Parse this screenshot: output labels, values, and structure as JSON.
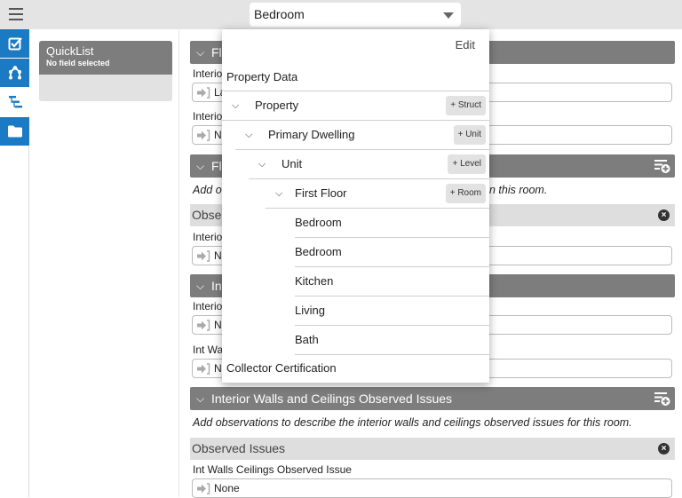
{
  "topbar": {
    "menu_icon": "hamburger-icon",
    "room_selector": {
      "value": "Bedroom",
      "icon": "caret-down-icon"
    }
  },
  "leftrail": {
    "items": [
      {
        "name": "checklist",
        "icon": "checkbox-icon",
        "active": true
      },
      {
        "name": "structure",
        "icon": "node-graph-icon",
        "active": true
      },
      {
        "name": "hierarchy",
        "icon": "tree-hierarchy-icon",
        "active": false
      },
      {
        "name": "files",
        "icon": "folder-icon",
        "active": true
      }
    ]
  },
  "quicklist": {
    "title": "QuickList",
    "subtitle": "No field selected"
  },
  "form": {
    "sections": [
      {
        "title": "Flooring",
        "title_visible": "Flo",
        "fields": [
          {
            "label": "Interior",
            "label_visible": "Interio",
            "value_visible": "La"
          },
          {
            "label": "Interior",
            "label_visible": "Interio",
            "value_visible": "No"
          }
        ]
      },
      {
        "title": "Flooring Observed Issues",
        "title_visible": "Flo",
        "description_visible_start": "Add o",
        "description_visible_end": "n this room.",
        "observation_bar": "Obser",
        "fields": [
          {
            "label": "Interior",
            "label_visible": "Interio",
            "value_visible": "No"
          }
        ]
      },
      {
        "title": "Interior Walls and Ceilings",
        "title_visible": "Int",
        "fields": [
          {
            "label": "Interior",
            "label_visible": "Interio",
            "value_visible": "No"
          },
          {
            "label": "Int Walls",
            "label_visible": "Int Wa",
            "value_visible": "No"
          }
        ]
      },
      {
        "title": "Interior Walls and Ceilings Observed Issues",
        "description": "Add observations to describe the interior walls and ceilings observed issues for this room.",
        "observation_bar": "Observed Issues",
        "fields": [
          {
            "label": "Int Walls Ceilings Observed Issue",
            "value": "None"
          }
        ]
      }
    ]
  },
  "popover": {
    "edit_label": "Edit",
    "header": "Property Data",
    "tree": [
      {
        "label": "Property",
        "level": 0,
        "collapsible": true,
        "add_button": "+ Struct"
      },
      {
        "label": "Primary Dwelling",
        "level": 1,
        "collapsible": true,
        "add_button": "+ Unit"
      },
      {
        "label": "Unit",
        "level": 2,
        "collapsible": true,
        "add_button": "+ Level"
      },
      {
        "label": "First Floor",
        "level": 3,
        "collapsible": true,
        "add_button": "+ Room"
      },
      {
        "label": "Bedroom",
        "level": 4
      },
      {
        "label": "Bedroom",
        "level": 4
      },
      {
        "label": "Kitchen",
        "level": 4
      },
      {
        "label": "Living",
        "level": 4
      },
      {
        "label": "Bath",
        "level": 4
      }
    ],
    "footer": "Collector Certification"
  },
  "colors": {
    "accent_blue": "#1a7ac4",
    "section_header_gray": "#7d7d7d",
    "observation_bar_gray": "#dedede"
  }
}
